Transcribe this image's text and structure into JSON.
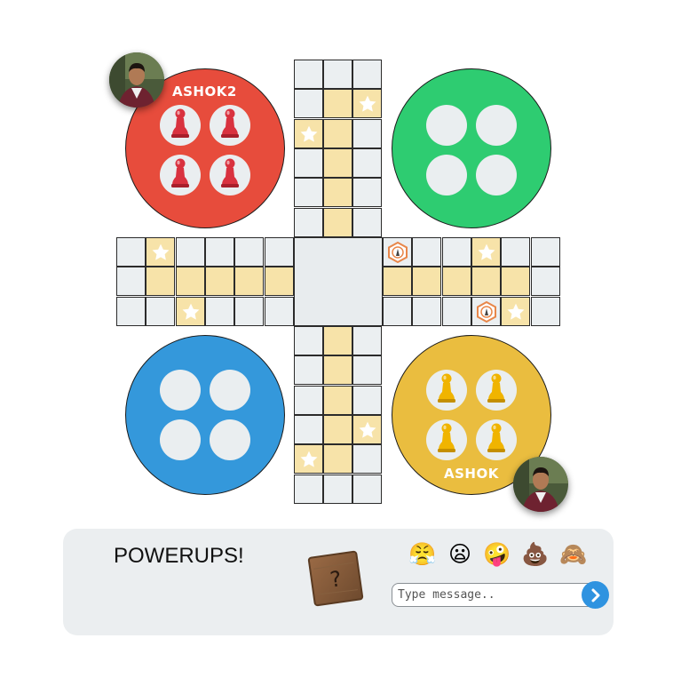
{
  "colors": {
    "red": "#e74c3c",
    "green": "#2ecc71",
    "blue": "#3498db",
    "yellow": "#eabd3f",
    "board_cell": "#ebeff1",
    "home_path": "#f7e3a9",
    "send_button": "#2f93e0"
  },
  "players": {
    "red": {
      "name": "ASHOK2",
      "tokens_at_home": 4
    },
    "yellow": {
      "name": "ASHOK",
      "tokens_at_home": 4
    }
  },
  "board": {
    "star_icon": "star-icon",
    "powerup_icon": "powerup-token-icon"
  },
  "powerups": {
    "label": "POWERUPS!",
    "box_symbol": "?"
  },
  "chat": {
    "emojis": [
      "😤",
      "😦",
      "🤪",
      "💩",
      "🙈"
    ],
    "placeholder": "Type message..",
    "send_icon": "chevron-right-icon"
  }
}
